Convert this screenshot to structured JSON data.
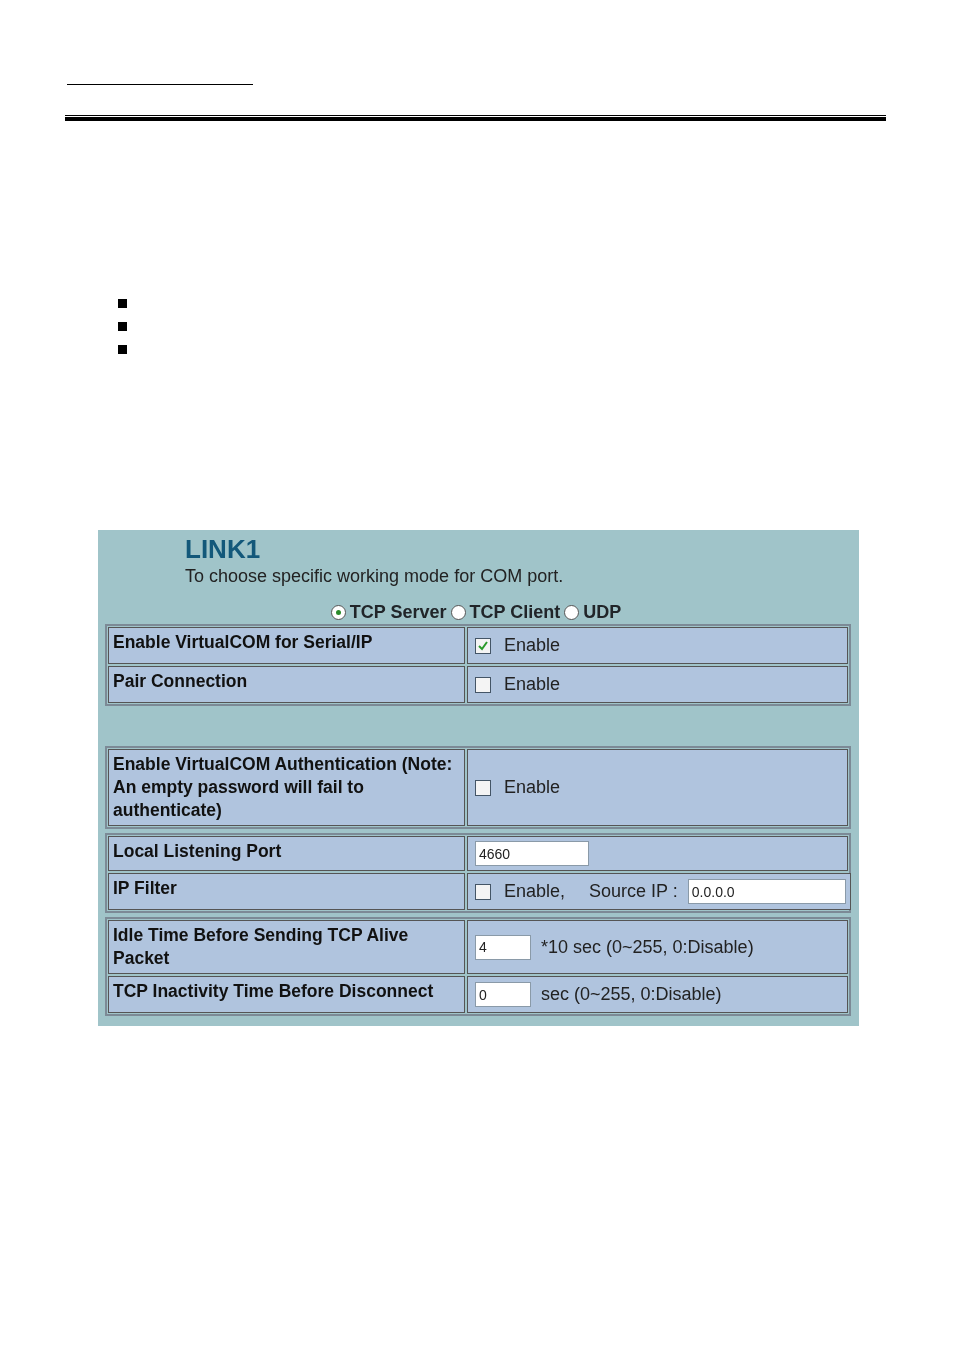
{
  "panel": {
    "title": "LINK1",
    "description": "To choose specific working mode for COM port.",
    "modes": [
      {
        "label": "TCP Server",
        "selected": true
      },
      {
        "label": "TCP Client",
        "selected": false
      },
      {
        "label": "UDP",
        "selected": false
      }
    ],
    "groups": [
      {
        "rows": [
          {
            "label": "Enable VirtualCOM for Serial/IP",
            "parts": [
              {
                "kind": "checkbox",
                "label": "Enable",
                "checked": true
              }
            ]
          },
          {
            "label": "Pair Connection",
            "parts": [
              {
                "kind": "checkbox",
                "label": "Enable",
                "checked": false
              }
            ]
          }
        ]
      },
      {
        "rows": [
          {
            "label": "Enable VirtualCOM Authentication (Note: An empty password will fail to authenticate)",
            "parts": [
              {
                "kind": "checkbox",
                "label": "Enable",
                "checked": false
              }
            ]
          }
        ]
      },
      {
        "rows": [
          {
            "label": "Local Listening Port",
            "parts": [
              {
                "kind": "input",
                "value": "4660"
              }
            ]
          },
          {
            "label": "IP Filter",
            "parts": [
              {
                "kind": "checkbox",
                "label": "Enable,",
                "checked": false
              },
              {
                "kind": "text",
                "text": "Source IP :"
              },
              {
                "kind": "input",
                "value": "0.0.0.0"
              }
            ]
          }
        ]
      },
      {
        "rows": [
          {
            "label": "Idle Time Before Sending TCP Alive Packet",
            "parts": [
              {
                "kind": "input",
                "value": "4"
              },
              {
                "kind": "text",
                "text": "*10 sec (0~255, 0:Disable)"
              }
            ]
          },
          {
            "label": "TCP Inactivity Time Before Disconnect",
            "parts": [
              {
                "kind": "input",
                "value": "0"
              },
              {
                "kind": "text",
                "text": "sec (0~255, 0:Disable)"
              }
            ]
          }
        ]
      }
    ]
  }
}
